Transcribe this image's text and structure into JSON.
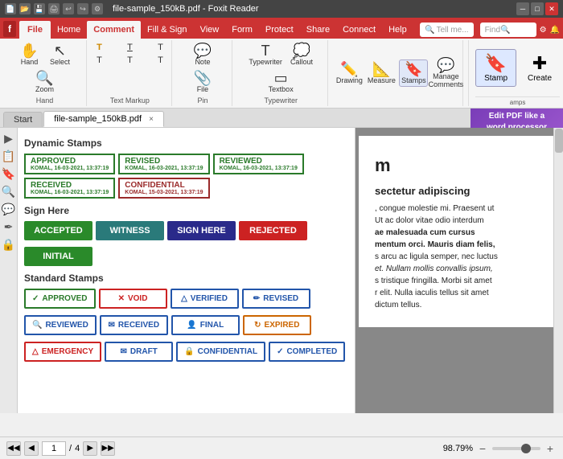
{
  "titlebar": {
    "title": "file-sample_150kB.pdf - Foxit Reader",
    "icons": [
      "file-icon",
      "save-icon",
      "print-icon",
      "back-icon",
      "forward-icon",
      "config-icon"
    ]
  },
  "menus": {
    "tabs": [
      "File",
      "Home",
      "Comment",
      "Fill & Sign",
      "View",
      "Form",
      "Protect",
      "Share",
      "Connect",
      "Help"
    ]
  },
  "active_menu": "Comment",
  "ribbon": {
    "groups": [
      {
        "name": "Hand",
        "items": [
          "Hand",
          "Select",
          "Zoom"
        ]
      },
      {
        "name": "Text Markup",
        "items": [
          "T",
          "T",
          "T",
          "T",
          "T",
          "T"
        ]
      },
      {
        "name": "Pin",
        "items": [
          "Note",
          "File"
        ]
      },
      {
        "name": "Typewriter",
        "items": [
          "Typewriter",
          "Callout",
          "Textbox"
        ]
      },
      {
        "name": "",
        "items": [
          "Drawing",
          "Measure",
          "Stamps",
          "Manage Comments"
        ]
      }
    ],
    "stamp_btn": "Stamp",
    "create_btn": "Create"
  },
  "tabs": {
    "tab1": "Start",
    "tab2": "file-sample_150kB.pdf",
    "close_label": "×"
  },
  "edit_pdf": {
    "line1": "Edit PDF like a",
    "line2": "word processor"
  },
  "stamp_panel": {
    "dynamic_section": "Dynamic Stamps",
    "sign_section": "Sign Here",
    "standard_section": "Standard Stamps",
    "dynamic_stamps": [
      {
        "label": "APPROVED",
        "sub": "KOMAL, 16-03-2021, 13:37:19",
        "color": "green"
      },
      {
        "label": "REVISED",
        "sub": "KOMAL, 16-03-2021, 13:37:19",
        "color": "green"
      },
      {
        "label": "REVIEWED",
        "sub": "KOMAL, 16-03-2021, 13:37:19",
        "color": "green"
      },
      {
        "label": "RECEIVED",
        "sub": "KOMAL, 16-03-2021, 13:37:19",
        "color": "green"
      },
      {
        "label": "CONFIDENTIAL",
        "sub": "KOMAL, 15-03-2021, 13:37:19",
        "color": "red"
      }
    ],
    "sign_stamps": [
      {
        "label": "ACCEPTED",
        "color": "green"
      },
      {
        "label": "WITNESS",
        "color": "teal"
      },
      {
        "label": "SIGN HERE",
        "color": "blue"
      },
      {
        "label": "REJECTED",
        "color": "red"
      },
      {
        "label": "INITIAL",
        "color": "green"
      }
    ],
    "standard_stamps": [
      {
        "label": "APPROVED",
        "icon": "✓",
        "color": "green"
      },
      {
        "label": "VOID",
        "icon": "✕",
        "color": "red"
      },
      {
        "label": "VERIFIED",
        "icon": "△",
        "color": "blue"
      },
      {
        "label": "REVISED",
        "icon": "✏",
        "color": "blue"
      },
      {
        "label": "REVIEWED",
        "icon": "🔍",
        "color": "blue"
      },
      {
        "label": "RECEIVED",
        "icon": "✉",
        "color": "blue"
      },
      {
        "label": "FINAL",
        "icon": "👤",
        "color": "blue"
      },
      {
        "label": "EXPIRED",
        "icon": "↻",
        "color": "orange"
      },
      {
        "label": "EMERGENCY",
        "icon": "△",
        "color": "red"
      },
      {
        "label": "DRAFT",
        "icon": "✉",
        "color": "blue"
      },
      {
        "label": "CONFIDENTIAL",
        "icon": "🔒",
        "color": "blue"
      },
      {
        "label": "COMPLETED",
        "icon": "✓",
        "color": "blue"
      }
    ]
  },
  "document": {
    "heading": "m",
    "para1": "sectetur adipiscing",
    "para2": ", congue molestie mi. Praesent ut",
    "para3": "Ut ac dolor vitae odio interdum",
    "para4": "ae malesuada cum cursus",
    "para5": "mentum orci. Mauris diam felis,",
    "para6": "s arcu ac ligula semper, nec luctus",
    "para7": "et. Nullam mollis convallis ipsum,",
    "para8": "s tristique fringilla. Morbi sit amet",
    "para9": "r elit. Nulla iaculis tellus sit amet",
    "para10": "dictum tellus."
  },
  "bottom": {
    "page_current": "1",
    "page_total": "4",
    "zoom": "98.79%",
    "nav_first": "◀◀",
    "nav_prev": "◀",
    "nav_next": "▶",
    "nav_last": "▶▶"
  },
  "search": {
    "placeholder": "Tell me...",
    "find_placeholder": "Find"
  }
}
